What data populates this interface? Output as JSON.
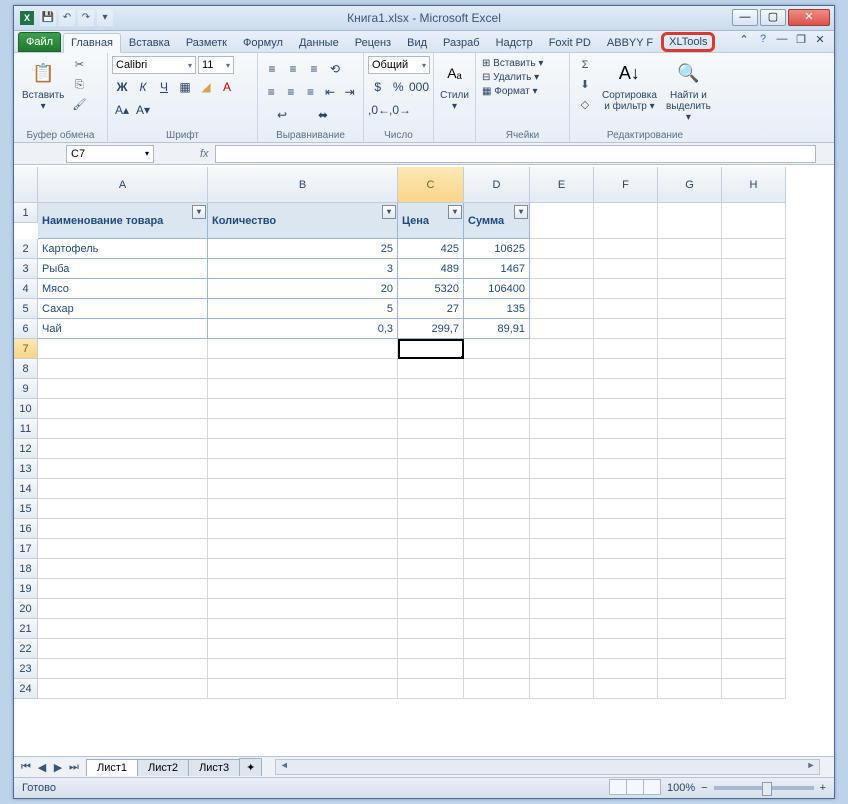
{
  "title": "Книга1.xlsx - Microsoft Excel",
  "qat": [
    "💾",
    "↶",
    "↷",
    "▾"
  ],
  "tabs": {
    "file": "Файл",
    "items": [
      "Главная",
      "Вставка",
      "Разметк",
      "Формул",
      "Данные",
      "Реценз",
      "Вид",
      "Разраб",
      "Надстр",
      "Foxit PD",
      "ABBYY F",
      "XLTools"
    ],
    "active": 0,
    "highlight": 11
  },
  "ribbon": {
    "clipboard": {
      "label": "Буфер обмена",
      "paste": "Вставить"
    },
    "font": {
      "label": "Шрифт",
      "name": "Calibri",
      "size": "11"
    },
    "align": {
      "label": "Выравнивание"
    },
    "number": {
      "label": "Число",
      "format": "Общий"
    },
    "styles": {
      "label": "",
      "btn": "Стили"
    },
    "cells": {
      "label": "Ячейки",
      "insert": "Вставить",
      "delete": "Удалить",
      "format": "Формат"
    },
    "editing": {
      "label": "Редактирование",
      "sort": "Сортировка\nи фильтр",
      "find": "Найти и\nвыделить"
    }
  },
  "namebox": "C7",
  "formula": "",
  "columns": [
    "A",
    "B",
    "C",
    "D",
    "E",
    "F",
    "G",
    "H"
  ],
  "activeCol": 2,
  "rows": 24,
  "activeRow": 7,
  "table": {
    "headers": [
      "Наименование товара",
      "Количество",
      "Цена",
      "Сумма"
    ],
    "data": [
      [
        "Картофель",
        "25",
        "425",
        "10625"
      ],
      [
        "Рыба",
        "3",
        "489",
        "1467"
      ],
      [
        "Мясо",
        "20",
        "5320",
        "106400"
      ],
      [
        "Сахар",
        "5",
        "27",
        "135"
      ],
      [
        "Чай",
        "0,3",
        "299,7",
        "89,91"
      ]
    ]
  },
  "sheets": [
    "Лист1",
    "Лист2",
    "Лист3"
  ],
  "activeSheet": 0,
  "status": {
    "ready": "Готово",
    "zoom": "100%"
  }
}
